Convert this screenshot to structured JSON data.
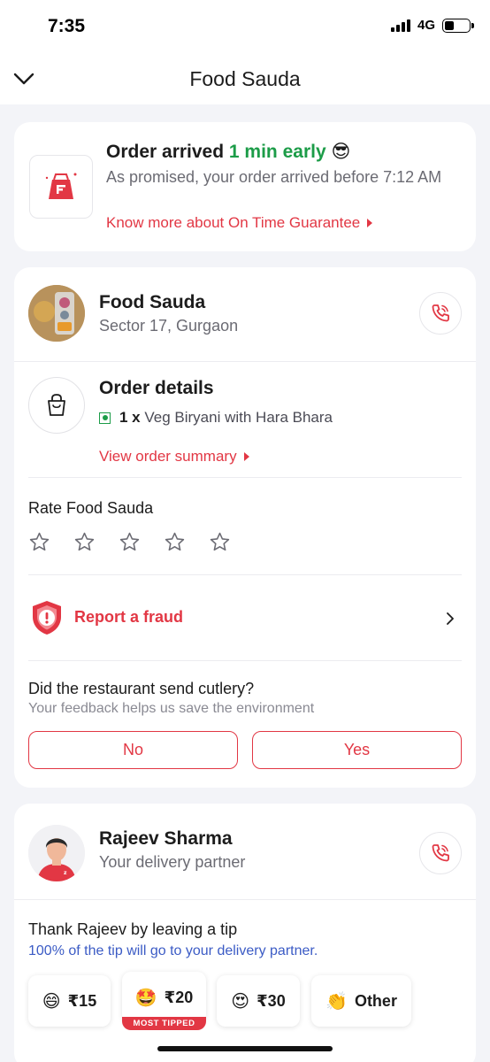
{
  "status_bar": {
    "time": "7:35",
    "network": "4G"
  },
  "header": {
    "title": "Food Sauda"
  },
  "on_time": {
    "title_prefix": "Order arrived ",
    "title_highlight": "1 min early",
    "title_emoji": "😎",
    "subtitle": "As promised, your order arrived before 7:12 AM",
    "link": "Know more about On Time Guarantee"
  },
  "restaurant": {
    "name": "Food Sauda",
    "location": "Sector 17, Gurgaon"
  },
  "order_details": {
    "title": "Order details",
    "quantity": "1 x",
    "item": "Veg Biryani with Hara Bhara",
    "link": "View order summary"
  },
  "rating": {
    "label": "Rate Food Sauda",
    "stars": 0,
    "max_stars": 5
  },
  "fraud": {
    "label": "Report a fraud"
  },
  "cutlery": {
    "question": "Did the restaurant send cutlery?",
    "subtitle": "Your feedback helps us save the environment",
    "no_label": "No",
    "yes_label": "Yes"
  },
  "delivery_partner": {
    "name": "Rajeev Sharma",
    "role": "Your delivery partner"
  },
  "tip": {
    "title": "Thank Rajeev by leaving a tip",
    "subtitle": "100% of the tip will go to your delivery partner.",
    "options": [
      {
        "emoji": "😄",
        "label": "₹15"
      },
      {
        "emoji": "🤩",
        "label": "₹20",
        "badge": "MOST TIPPED"
      },
      {
        "emoji": "😍",
        "label": "₹30"
      },
      {
        "emoji": "👏",
        "label": "Other"
      }
    ]
  },
  "colors": {
    "accent": "#e23744",
    "success": "#1c9c48",
    "info": "#3b5bc5"
  }
}
